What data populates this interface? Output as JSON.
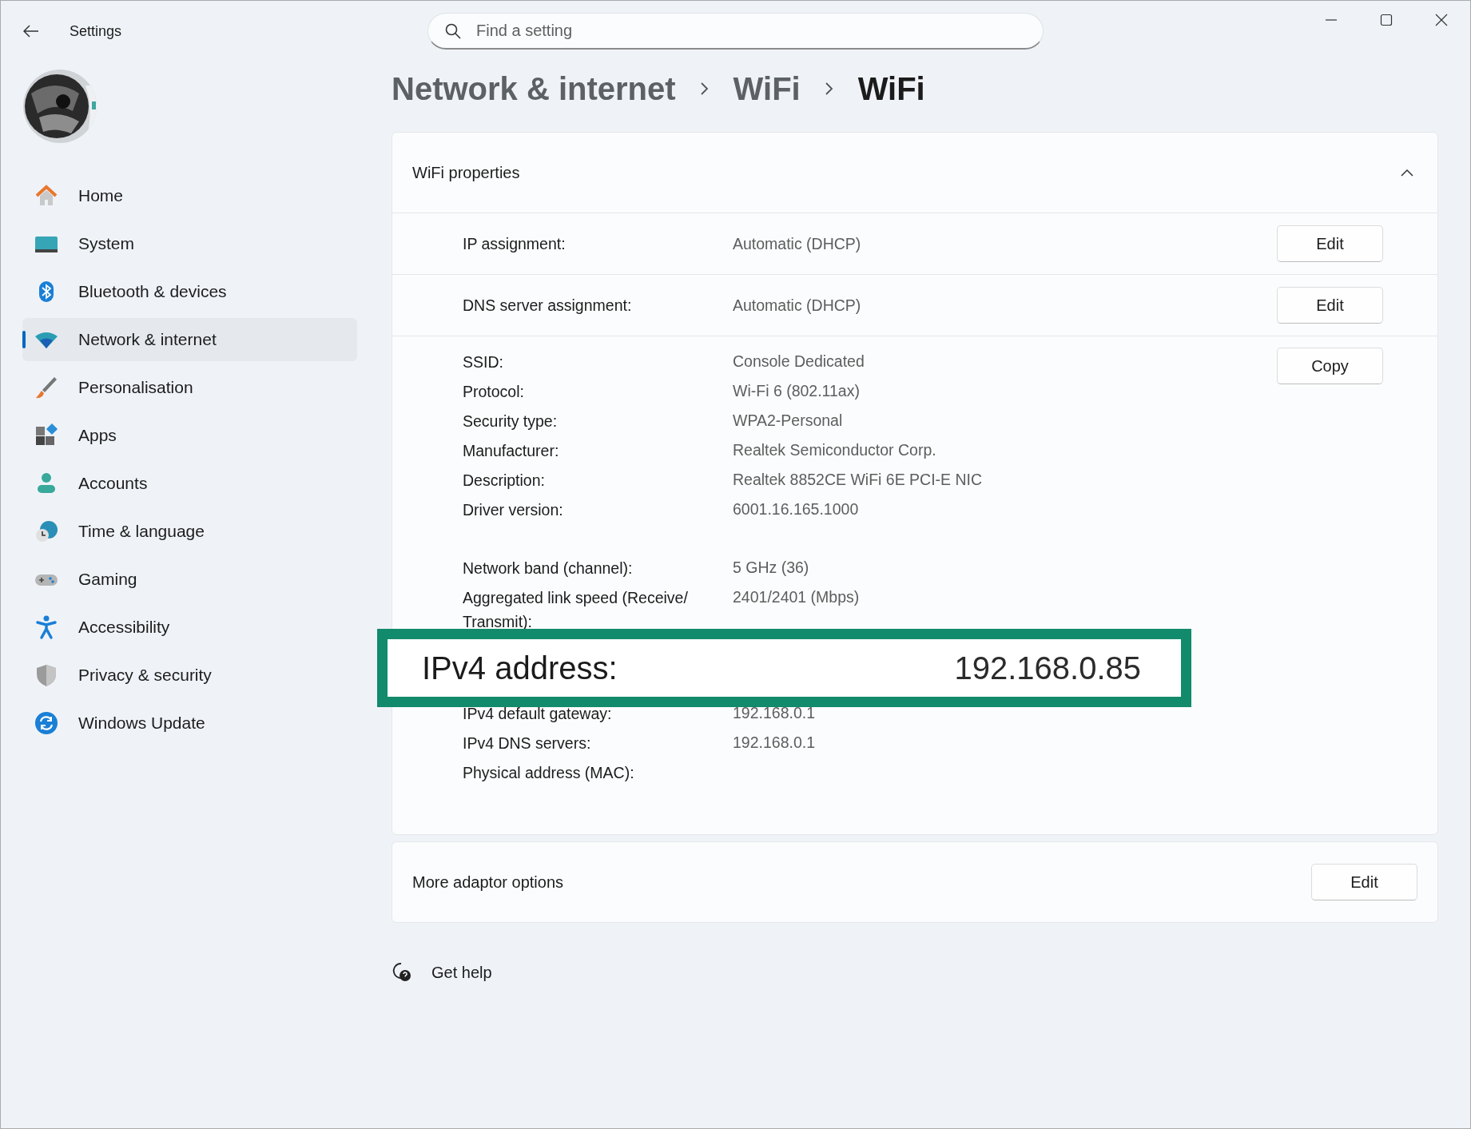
{
  "window": {
    "title": "Settings"
  },
  "search": {
    "placeholder": "Find a setting"
  },
  "sidebar": {
    "items": [
      {
        "label": "Home",
        "selected": false
      },
      {
        "label": "System",
        "selected": false
      },
      {
        "label": "Bluetooth & devices",
        "selected": false
      },
      {
        "label": "Network & internet",
        "selected": true
      },
      {
        "label": "Personalisation",
        "selected": false
      },
      {
        "label": "Apps",
        "selected": false
      },
      {
        "label": "Accounts",
        "selected": false
      },
      {
        "label": "Time & language",
        "selected": false
      },
      {
        "label": "Gaming",
        "selected": false
      },
      {
        "label": "Accessibility",
        "selected": false
      },
      {
        "label": "Privacy & security",
        "selected": false
      },
      {
        "label": "Windows Update",
        "selected": false
      }
    ]
  },
  "breadcrumb": [
    {
      "label": "Network & internet",
      "selected": false
    },
    {
      "label": "WiFi",
      "selected": false
    },
    {
      "label": "WiFi",
      "selected": true
    }
  ],
  "properties": {
    "title": "WiFi properties",
    "expanded": true,
    "settings": [
      {
        "label": "IP assignment:",
        "value": "Automatic (DHCP)",
        "button": "Edit"
      },
      {
        "label": "DNS server assignment:",
        "value": "Automatic (DHCP)",
        "button": "Edit"
      }
    ],
    "details_button": "Copy",
    "detail_groups": [
      [
        {
          "label": "SSID:",
          "value": "Console Dedicated"
        },
        {
          "label": "Protocol:",
          "value": "Wi-Fi 6 (802.11ax)"
        },
        {
          "label": "Security type:",
          "value": "WPA2-Personal"
        },
        {
          "label": "Manufacturer:",
          "value": "Realtek Semiconductor Corp."
        },
        {
          "label": "Description:",
          "value": "Realtek 8852CE WiFi 6E PCI-E NIC"
        },
        {
          "label": "Driver version:",
          "value": "6001.16.165.1000"
        }
      ],
      [
        {
          "label": "Network band (channel):",
          "value": "5 GHz (36)"
        },
        {
          "label": "Aggregated link speed (Receive/ Transmit):",
          "value": "2401/2401 (Mbps)"
        }
      ],
      [
        {
          "label": "IPv4 default gateway:",
          "value": "192.168.0.1"
        },
        {
          "label": "IPv4 DNS servers:",
          "value": "192.168.0.1"
        },
        {
          "label": "Physical address (MAC):"
        }
      ]
    ],
    "callout": {
      "label": "IPv4 address:",
      "value": "192.168.0.85"
    }
  },
  "adaptor": {
    "label": "More adaptor options",
    "button": "Edit"
  },
  "help": {
    "label": "Get help"
  }
}
